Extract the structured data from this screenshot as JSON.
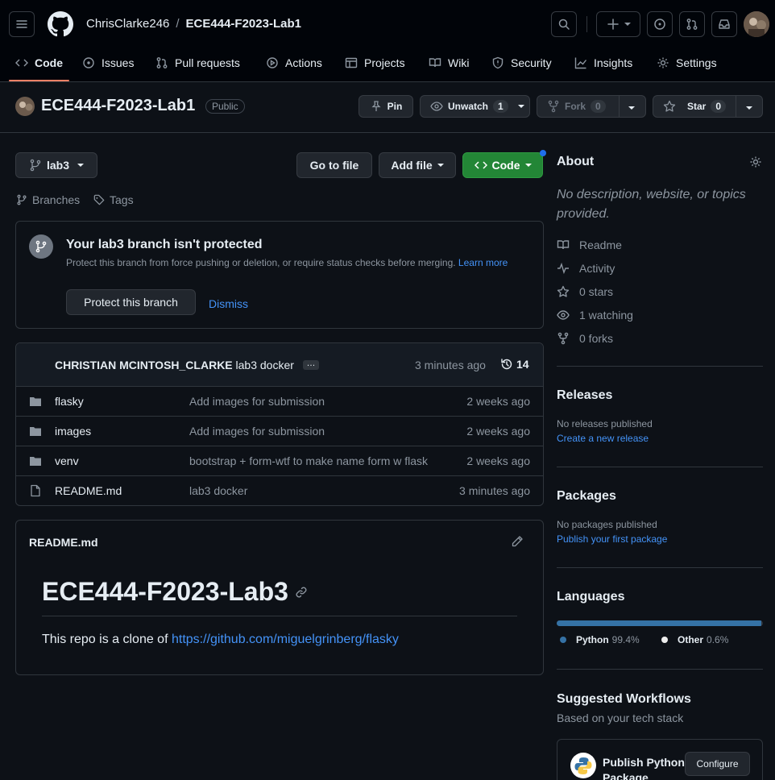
{
  "header": {
    "owner": "ChrisClarke246",
    "separator": "/",
    "repo": "ECE444-F2023-Lab1"
  },
  "tabs": [
    {
      "label": "Code"
    },
    {
      "label": "Issues"
    },
    {
      "label": "Pull requests"
    },
    {
      "label": "Actions"
    },
    {
      "label": "Projects"
    },
    {
      "label": "Wiki"
    },
    {
      "label": "Security"
    },
    {
      "label": "Insights"
    },
    {
      "label": "Settings"
    }
  ],
  "repo_header": {
    "name": "ECE444-F2023-Lab1",
    "visibility": "Public",
    "pin_label": "Pin",
    "unwatch_label": "Unwatch",
    "unwatch_count": "1",
    "fork_label": "Fork",
    "fork_count": "0",
    "star_label": "Star",
    "star_count": "0"
  },
  "toolbar": {
    "branch": "lab3",
    "go_to_file": "Go to file",
    "add_file": "Add file",
    "code": "Code",
    "branches": "Branches",
    "tags": "Tags"
  },
  "protect_banner": {
    "title": "Your lab3 branch isn't protected",
    "desc": "Protect this branch from force pushing or deletion, or require status checks before merging.",
    "learn": "Learn",
    "more": "more",
    "protect_btn": "Protect this branch",
    "dismiss": "Dismiss"
  },
  "commit": {
    "author": "CHRISTIAN MCINTOSH_CLARKE",
    "message": "lab3 docker",
    "ellipsis": "…",
    "time": "3 minutes ago",
    "count": "14"
  },
  "files": [
    {
      "name": "flasky",
      "type": "folder",
      "message": "Add images for submission",
      "date": "2 weeks ago"
    },
    {
      "name": "images",
      "type": "folder",
      "message": "Add images for submission",
      "date": "2 weeks ago"
    },
    {
      "name": "venv",
      "type": "folder",
      "message": "bootstrap + form-wtf to make name form w flask",
      "date": "2 weeks ago"
    },
    {
      "name": "README.md",
      "type": "file",
      "message": "lab3 docker",
      "date": "3 minutes ago"
    }
  ],
  "readme": {
    "filename": "README.md",
    "heading": "ECE444-F2023-Lab3",
    "text": "This repo is a clone of",
    "link": "https://github.com/miguelgrinberg/flasky"
  },
  "about": {
    "title": "About",
    "desc_line1": "No description, website, or topics",
    "desc_line2": "provided.",
    "items": [
      {
        "label": "Readme",
        "icon": "book-icon"
      },
      {
        "label": "Activity",
        "icon": "pulse-icon"
      },
      {
        "label": "0 stars",
        "icon": "star-icon"
      },
      {
        "label": "1 watching",
        "icon": "eye-icon"
      },
      {
        "label": "0 forks",
        "icon": "fork-icon"
      }
    ]
  },
  "releases": {
    "title": "Releases",
    "none": "No releases published",
    "create": "Create a new release"
  },
  "packages": {
    "title": "Packages",
    "none": "No packages published",
    "publish": "Publish your first package"
  },
  "languages": {
    "title": "Languages",
    "items": [
      {
        "name": "Python",
        "percent": "99.4%",
        "fraction": 0.994,
        "color": "#3572A5"
      },
      {
        "name": "Other",
        "percent": "0.6%",
        "fraction": 0.006,
        "color": "#ededed"
      }
    ]
  },
  "workflows": {
    "title": "Suggested Workflows",
    "subtitle": "Based on your tech stack",
    "card_title_1": "Publish Python",
    "card_title_2": "Package",
    "configure": "Configure"
  },
  "colors": {
    "accent": "#f78166",
    "green": "#238636",
    "link": "#4493f8",
    "notification": "#1f6feb"
  }
}
